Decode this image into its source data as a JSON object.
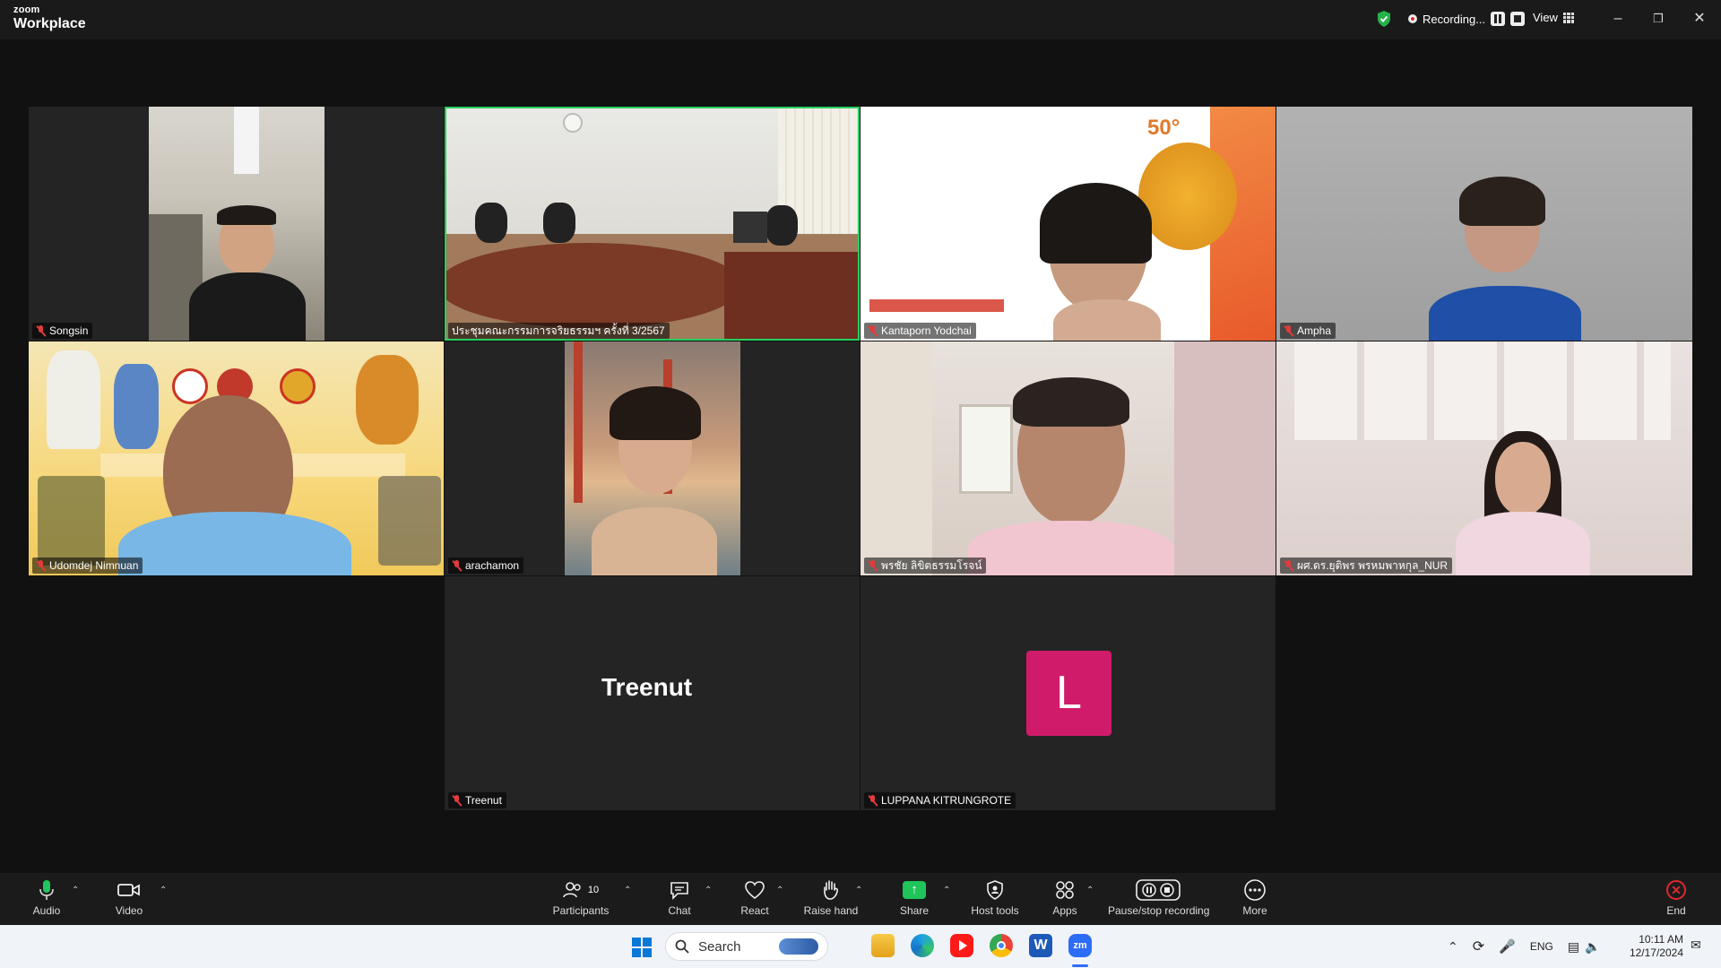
{
  "app": {
    "brand_small": "zoom",
    "brand_big": "Workplace"
  },
  "titlebar": {
    "recording_label": "Recording...",
    "view_label": "View"
  },
  "participants": [
    {
      "name": "Songsin",
      "muted": true
    },
    {
      "name": "ประชุมคณะกรรมการจริยธรรมฯ ครั้งที่ 3/2567",
      "muted": false,
      "active_speaker": true
    },
    {
      "name": "Kantaporn Yodchai",
      "muted": true
    },
    {
      "name": "Ampha",
      "muted": true
    },
    {
      "name": "Udomdej Nimnuan",
      "muted": true
    },
    {
      "name": "arachamon",
      "muted": true
    },
    {
      "name": "พรชัย ลิขิตธรรมโรจน์",
      "muted": true
    },
    {
      "name": "ผศ.ดร.ยุติพร พรหมพาหกุล_NUR",
      "muted": true
    },
    {
      "name": "Treenut",
      "muted": true,
      "video_off_label": "Treenut"
    },
    {
      "name": "LUPPANA KITRUNGROTE",
      "muted": true,
      "avatar_letter": "L"
    }
  ],
  "toolbar": {
    "audio": "Audio",
    "video": "Video",
    "participants": "Participants",
    "participants_count": "10",
    "chat": "Chat",
    "react": "React",
    "raise_hand": "Raise hand",
    "share": "Share",
    "host_tools": "Host tools",
    "apps": "Apps",
    "pause_stop": "Pause/stop recording",
    "more": "More",
    "end": "End"
  },
  "taskbar": {
    "search_placeholder": "Search",
    "lang": "ENG",
    "time": "10:11 AM",
    "date": "12/17/2024"
  },
  "colors": {
    "active_border": "#23d160",
    "avatar_bg": "#d01b6a",
    "end_red": "#e0292e",
    "share_green": "#1fc45a"
  }
}
